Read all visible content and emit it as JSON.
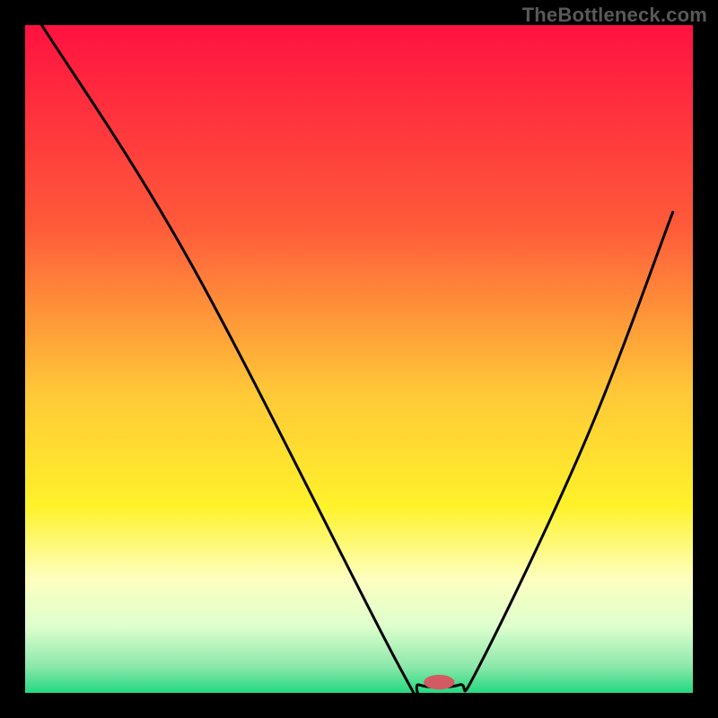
{
  "watermark": "TheBottleneck.com",
  "chart_data": {
    "type": "line",
    "title": "",
    "xlabel": "",
    "ylabel": "",
    "xlim": [
      0,
      100
    ],
    "ylim": [
      0,
      100
    ],
    "gradient_stops": [
      {
        "offset": 0,
        "color": "#ff1240"
      },
      {
        "offset": 30,
        "color": "#ff5a3a"
      },
      {
        "offset": 55,
        "color": "#ffc838"
      },
      {
        "offset": 72,
        "color": "#fff22a"
      },
      {
        "offset": 83,
        "color": "#fdffc0"
      },
      {
        "offset": 90,
        "color": "#deffcd"
      },
      {
        "offset": 96,
        "color": "#8de8ab"
      },
      {
        "offset": 100,
        "color": "#23d980"
      }
    ],
    "series": [
      {
        "name": "bottleneck-curve",
        "points": [
          {
            "x": 2.5,
            "y": 100
          },
          {
            "x": 25,
            "y": 64
          },
          {
            "x": 56,
            "y": 4
          },
          {
            "x": 59,
            "y": 1.2
          },
          {
            "x": 65,
            "y": 1.2
          },
          {
            "x": 68,
            "y": 4
          },
          {
            "x": 84,
            "y": 38
          },
          {
            "x": 97,
            "y": 72
          }
        ]
      }
    ],
    "marker": {
      "x": 62,
      "y": 1.6,
      "rx": 2.3,
      "ry": 1.1,
      "color": "#d35a63"
    }
  }
}
